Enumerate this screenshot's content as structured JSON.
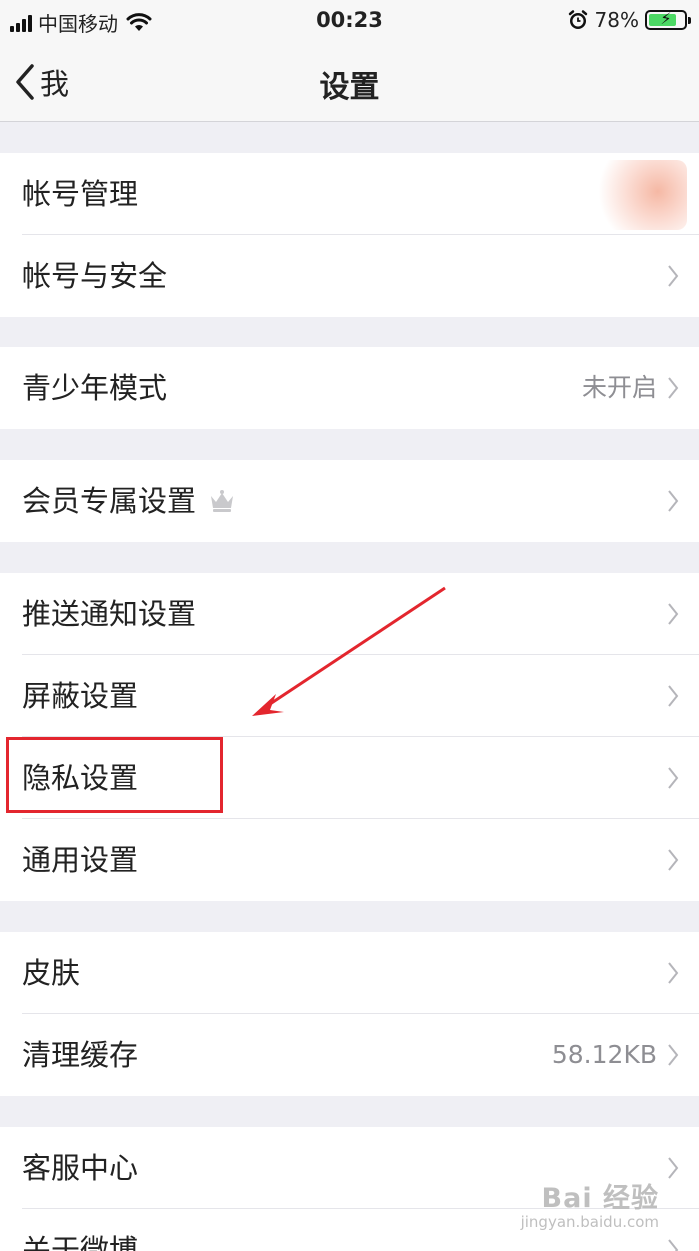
{
  "status_bar": {
    "carrier": "中国移动",
    "time": "00:23",
    "battery_percent": "78%",
    "battery_level": 0.78,
    "icons": [
      "signal-icon",
      "wifi-icon",
      "alarm-icon",
      "battery-charging-icon"
    ]
  },
  "nav": {
    "back_label": "我",
    "title": "设置"
  },
  "rows": [
    {
      "label": "帐号管理",
      "value": ""
    },
    {
      "label": "帐号与安全",
      "value": ""
    },
    {
      "label": "青少年模式",
      "value": "未开启"
    },
    {
      "label": "会员专属设置",
      "value": "",
      "icon": "crown-icon"
    },
    {
      "label": "推送通知设置",
      "value": ""
    },
    {
      "label": "屏蔽设置",
      "value": ""
    },
    {
      "label": "隐私设置",
      "value": "",
      "highlighted": true
    },
    {
      "label": "通用设置",
      "value": ""
    },
    {
      "label": "皮肤",
      "value": ""
    },
    {
      "label": "清理缓存",
      "value": "58.12KB"
    },
    {
      "label": "客服中心",
      "value": ""
    },
    {
      "label": "关于微博",
      "value": ""
    }
  ],
  "annotation": {
    "color": "#e3262e"
  },
  "watermark": {
    "main": "Bai 经验",
    "sub": "jingyan.baidu.com"
  }
}
